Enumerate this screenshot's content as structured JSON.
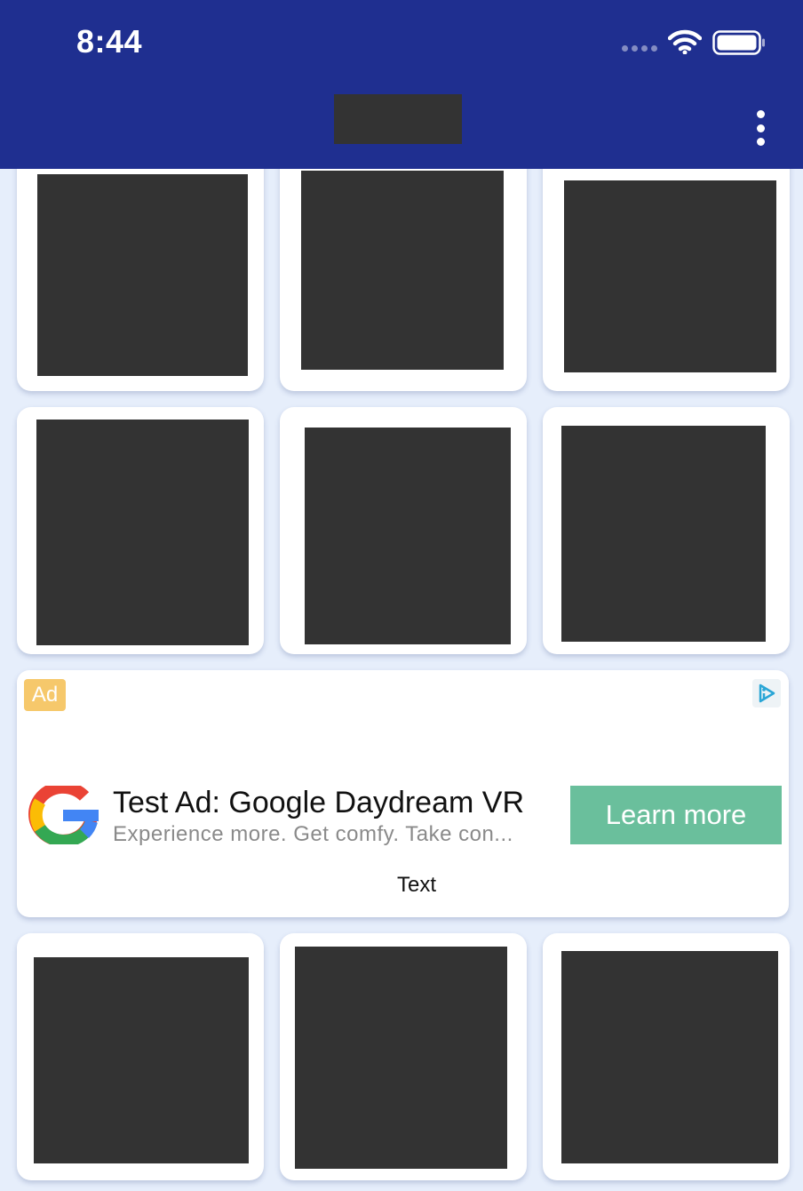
{
  "status_bar": {
    "time": "8:44"
  },
  "app_bar": {
    "menu_icon": "more-vertical-icon"
  },
  "ad": {
    "badge": "Ad",
    "headline": "Test Ad: Google Daydream VR",
    "body": "Experience more. Get comfy. Take con...",
    "cta": "Learn more",
    "footer_text": "Text",
    "adchoices_icon": "adchoices-icon",
    "logo_icon": "google-g-icon"
  },
  "colors": {
    "app_bar": "#1f2f90",
    "background": "#e6eefb",
    "cta": "#6abf9c",
    "badge": "#f6c86b",
    "redacted": "#333333"
  }
}
